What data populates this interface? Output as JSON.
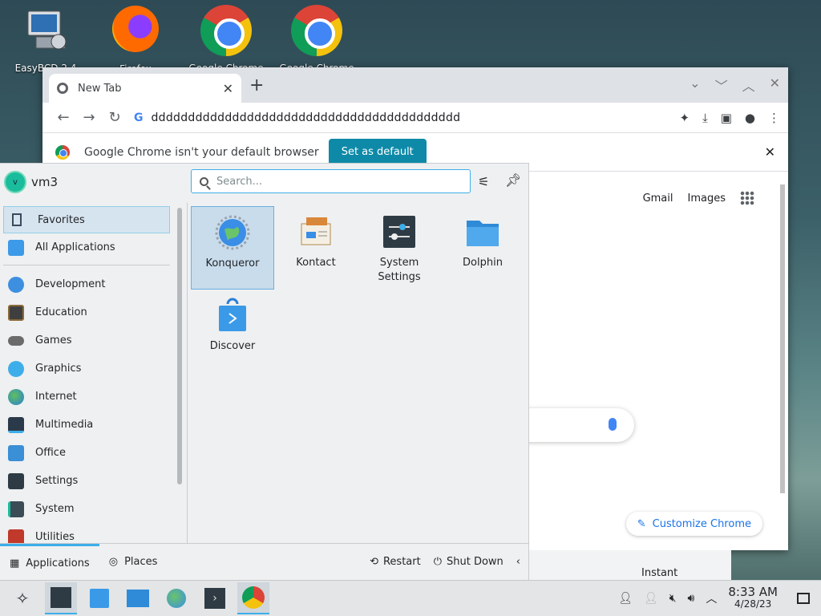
{
  "desktop": {
    "icons": [
      {
        "label": "EasyBCD 2.4"
      },
      {
        "label": "Firefox"
      },
      {
        "label": "Google Chrome"
      },
      {
        "label": "Google Chrome"
      }
    ]
  },
  "chrome": {
    "tab_title": "New Tab",
    "tab_close": "✕",
    "new_tab": "+",
    "url": "dddddddddddddddddddddddddddddddddddddddddd",
    "infobar_message": "Google Chrome isn't your default browser",
    "infobar_button": "Set as default",
    "infobar_close": "✕",
    "gmail": "Gmail",
    "images": "Images",
    "customize": "Customize Chrome"
  },
  "launcher": {
    "user": "vm3",
    "avatar_letter": "v",
    "search_placeholder": "Search...",
    "sidebar": [
      {
        "label": "Favorites",
        "color": "#5b6f86"
      },
      {
        "label": "All Applications",
        "color": "#3d9ae8"
      },
      {
        "label": "Development",
        "color": "#3d8fe0"
      },
      {
        "label": "Education",
        "color": "#3f3f3f"
      },
      {
        "label": "Games",
        "color": "#6b6b6b"
      },
      {
        "label": "Graphics",
        "color": "#3daee9"
      },
      {
        "label": "Internet",
        "color": "#2a9fd6"
      },
      {
        "label": "Multimedia",
        "color": "#2b3a4a"
      },
      {
        "label": "Office",
        "color": "#3a8fd6"
      },
      {
        "label": "Settings",
        "color": "#2f3b44"
      },
      {
        "label": "System",
        "color": "#3b4c56"
      },
      {
        "label": "Utilities",
        "color": "#c0392b"
      }
    ],
    "apps": [
      {
        "label": "Konqueror",
        "icon": "konqueror-icon"
      },
      {
        "label": "Kontact",
        "icon": "kontact-icon"
      },
      {
        "label": "System Settings",
        "icon": "system-settings-icon"
      },
      {
        "label": "Dolphin",
        "icon": "dolphin-icon"
      },
      {
        "label": "Discover",
        "icon": "discover-icon"
      }
    ],
    "footer": {
      "applications": "Applications",
      "places": "Places",
      "restart": "Restart",
      "shutdown": "Shut Down"
    }
  },
  "behind": {
    "instant": "Instant"
  },
  "taskbar": {
    "time": "8:33 AM",
    "date": "4/28/23"
  }
}
